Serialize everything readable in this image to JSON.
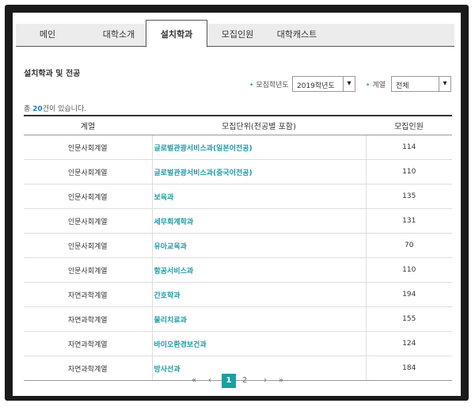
{
  "tabs": [
    {
      "label": "메인"
    },
    {
      "label": "대학소개"
    },
    {
      "label": "설치학과",
      "active": true
    },
    {
      "label": "모집인원"
    },
    {
      "label": "대학캐스트"
    }
  ],
  "section_title": "설치학과 및 전공",
  "filters": {
    "year_label": "모집학년도",
    "year_value": "2019학년도",
    "field_label": "계열",
    "field_value": "전체"
  },
  "count": {
    "prefix": "총 ",
    "num": "20",
    "suffix": "건이 있습니다."
  },
  "table": {
    "headers": [
      "계열",
      "모집단위(전공별 포함)",
      "모집인원"
    ],
    "rows": [
      {
        "field": "인문사회계열",
        "unit": "글로벌관광서비스과(일본어전공)",
        "count": "114"
      },
      {
        "field": "인문사회계열",
        "unit": "글로벌관광서비스과(중국어전공)",
        "count": "110"
      },
      {
        "field": "인문사회계열",
        "unit": "보육과",
        "count": "135"
      },
      {
        "field": "인문사회계열",
        "unit": "세무회계학과",
        "count": "131"
      },
      {
        "field": "인문사회계열",
        "unit": "유아교육과",
        "count": "70"
      },
      {
        "field": "인문사회계열",
        "unit": "항공서비스과",
        "count": "110"
      },
      {
        "field": "자연과학계열",
        "unit": "간호학과",
        "count": "194"
      },
      {
        "field": "자연과학계열",
        "unit": "물리치료과",
        "count": "155"
      },
      {
        "field": "자연과학계열",
        "unit": "바이오환경보건과",
        "count": "124"
      },
      {
        "field": "자연과학계열",
        "unit": "방사선과",
        "count": "184"
      }
    ]
  },
  "pager": {
    "first": "«",
    "prev": "‹",
    "pages": [
      "1",
      "2"
    ],
    "current": "1",
    "next": "›",
    "last": "»"
  }
}
